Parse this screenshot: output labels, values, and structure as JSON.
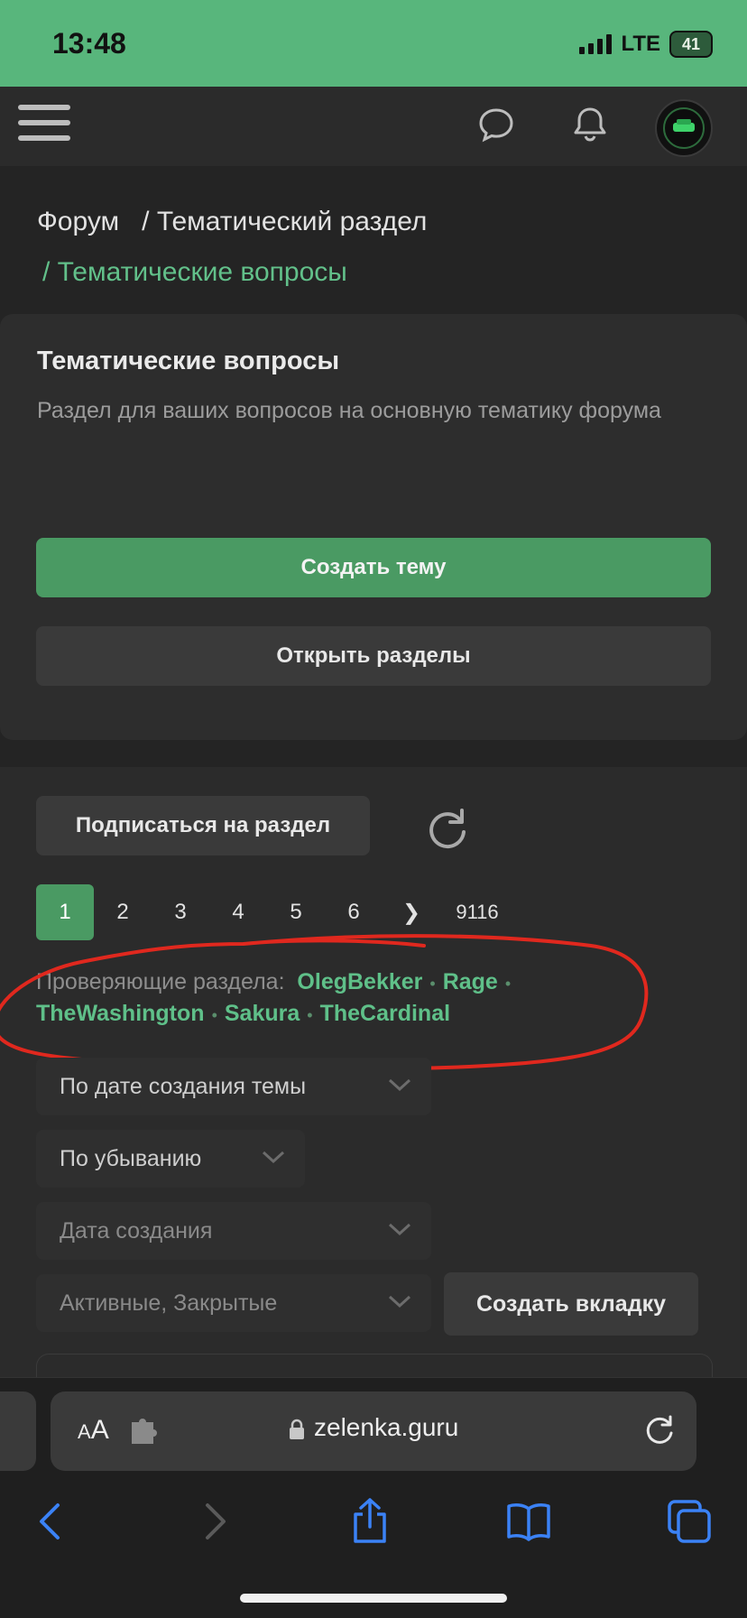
{
  "status_bar": {
    "time": "13:48",
    "network": "LTE",
    "battery": "41"
  },
  "header": {
    "menu_icon": "hamburger-icon",
    "chat_icon": "chat-bubble-icon",
    "bell_icon": "bell-icon"
  },
  "breadcrumb": {
    "root": "Форум",
    "section": "/ Тематический раздел",
    "current": "/ Тематические вопросы"
  },
  "forum": {
    "title": "Тематические вопросы",
    "description": "Раздел для ваших вопросов на основную тематику форума",
    "create_topic": "Создать тему",
    "open_sections": "Открыть разделы",
    "subscribe": "Подписаться на раздел"
  },
  "pagination": {
    "pages": [
      "1",
      "2",
      "3",
      "4",
      "5",
      "6"
    ],
    "next": "❯",
    "last": "9116",
    "current": "1"
  },
  "moderators": {
    "label": "Проверяющие раздела:",
    "names": [
      "OlegBekker",
      "Rage",
      "TheWashington",
      "Sakura",
      "TheCardinal"
    ]
  },
  "filters": {
    "sort_by": "По дате создания темы",
    "order": "По убыванию",
    "date": "Дата создания",
    "state": "Активные, Закрытые",
    "create_tab": "Создать вкладку"
  },
  "browser": {
    "text_size": "AA",
    "url": "zelenka.guru"
  },
  "colors": {
    "accent": "#4a9a63",
    "status_bar": "#58b67c",
    "annotation": "#e0281e"
  }
}
